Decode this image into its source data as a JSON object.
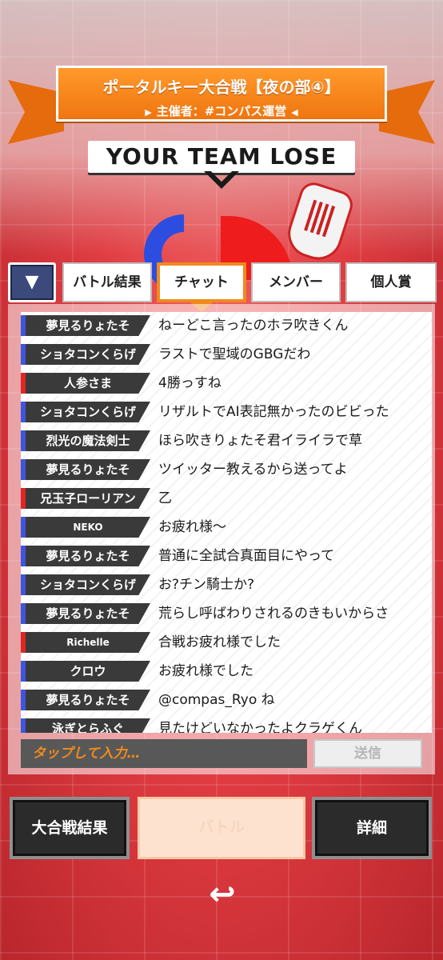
{
  "banner": {
    "title": "ポータルキー大合戦【夜の部④】",
    "subtitle": "主催者：#コンパス運営",
    "arrow_left": "▶",
    "arrow_right": "◀"
  },
  "result": {
    "heading": "YOUR TEAM LOSE"
  },
  "tabs": {
    "dropdown_icon": "▼",
    "items": [
      {
        "label": "バトル結果"
      },
      {
        "label": "チャット"
      },
      {
        "label": "メンバー"
      },
      {
        "label": "個人賞"
      }
    ],
    "active": "チャット"
  },
  "chat": {
    "messages": [
      {
        "name": "夢見るりょたそ",
        "team": "blue",
        "text": "ねーどこ言ったのホラ吹きくん"
      },
      {
        "name": "ショタコンくらげ",
        "team": "blue",
        "text": "ラストで聖域のGBGだわ"
      },
      {
        "name": "人参さま",
        "team": "red",
        "text": "4勝っすね"
      },
      {
        "name": "ショタコンくらげ",
        "team": "blue",
        "text": "リザルトでAI表記無かったのビビった"
      },
      {
        "name": "烈光の魔法剣士",
        "team": "blue",
        "text": "ほら吹きりょたそ君イライラで草"
      },
      {
        "name": "夢見るりょたそ",
        "team": "blue",
        "text": "ツイッター教えるから送ってよ"
      },
      {
        "name": "兄玉子ローリアン",
        "team": "red",
        "text": "乙"
      },
      {
        "name": "NEKO",
        "team": "blue",
        "text": "お疲れ様〜"
      },
      {
        "name": "夢見るりょたそ",
        "team": "blue",
        "text": "普通に全試合真面目にやって"
      },
      {
        "name": "ショタコンくらげ",
        "team": "blue",
        "text": "お?チン騎士か?"
      },
      {
        "name": "夢見るりょたそ",
        "team": "blue",
        "text": "荒らし呼ばわりされるのきもいからさ"
      },
      {
        "name": "Richelle",
        "team": "red",
        "text": "合戦お疲れ様でした"
      },
      {
        "name": "クロウ",
        "team": "blue",
        "text": "お疲れ様でした"
      },
      {
        "name": "夢見るりょたそ",
        "team": "blue",
        "text": "@compas_Ryo ね"
      },
      {
        "name": "泳ぎとらふぐ",
        "team": "blue",
        "text": "見たけどいなかったよクラゲくん"
      }
    ],
    "input_placeholder": "タップして入力…",
    "send_label": "送信"
  },
  "bottom": {
    "left_label": "大合戦結果",
    "middle_label": "バトル",
    "right_label": "詳細",
    "back_icon": "↩"
  },
  "colors": {
    "accent_orange": "#f08a1c",
    "team_blue": "#3c56e0",
    "team_red": "#e02525"
  }
}
